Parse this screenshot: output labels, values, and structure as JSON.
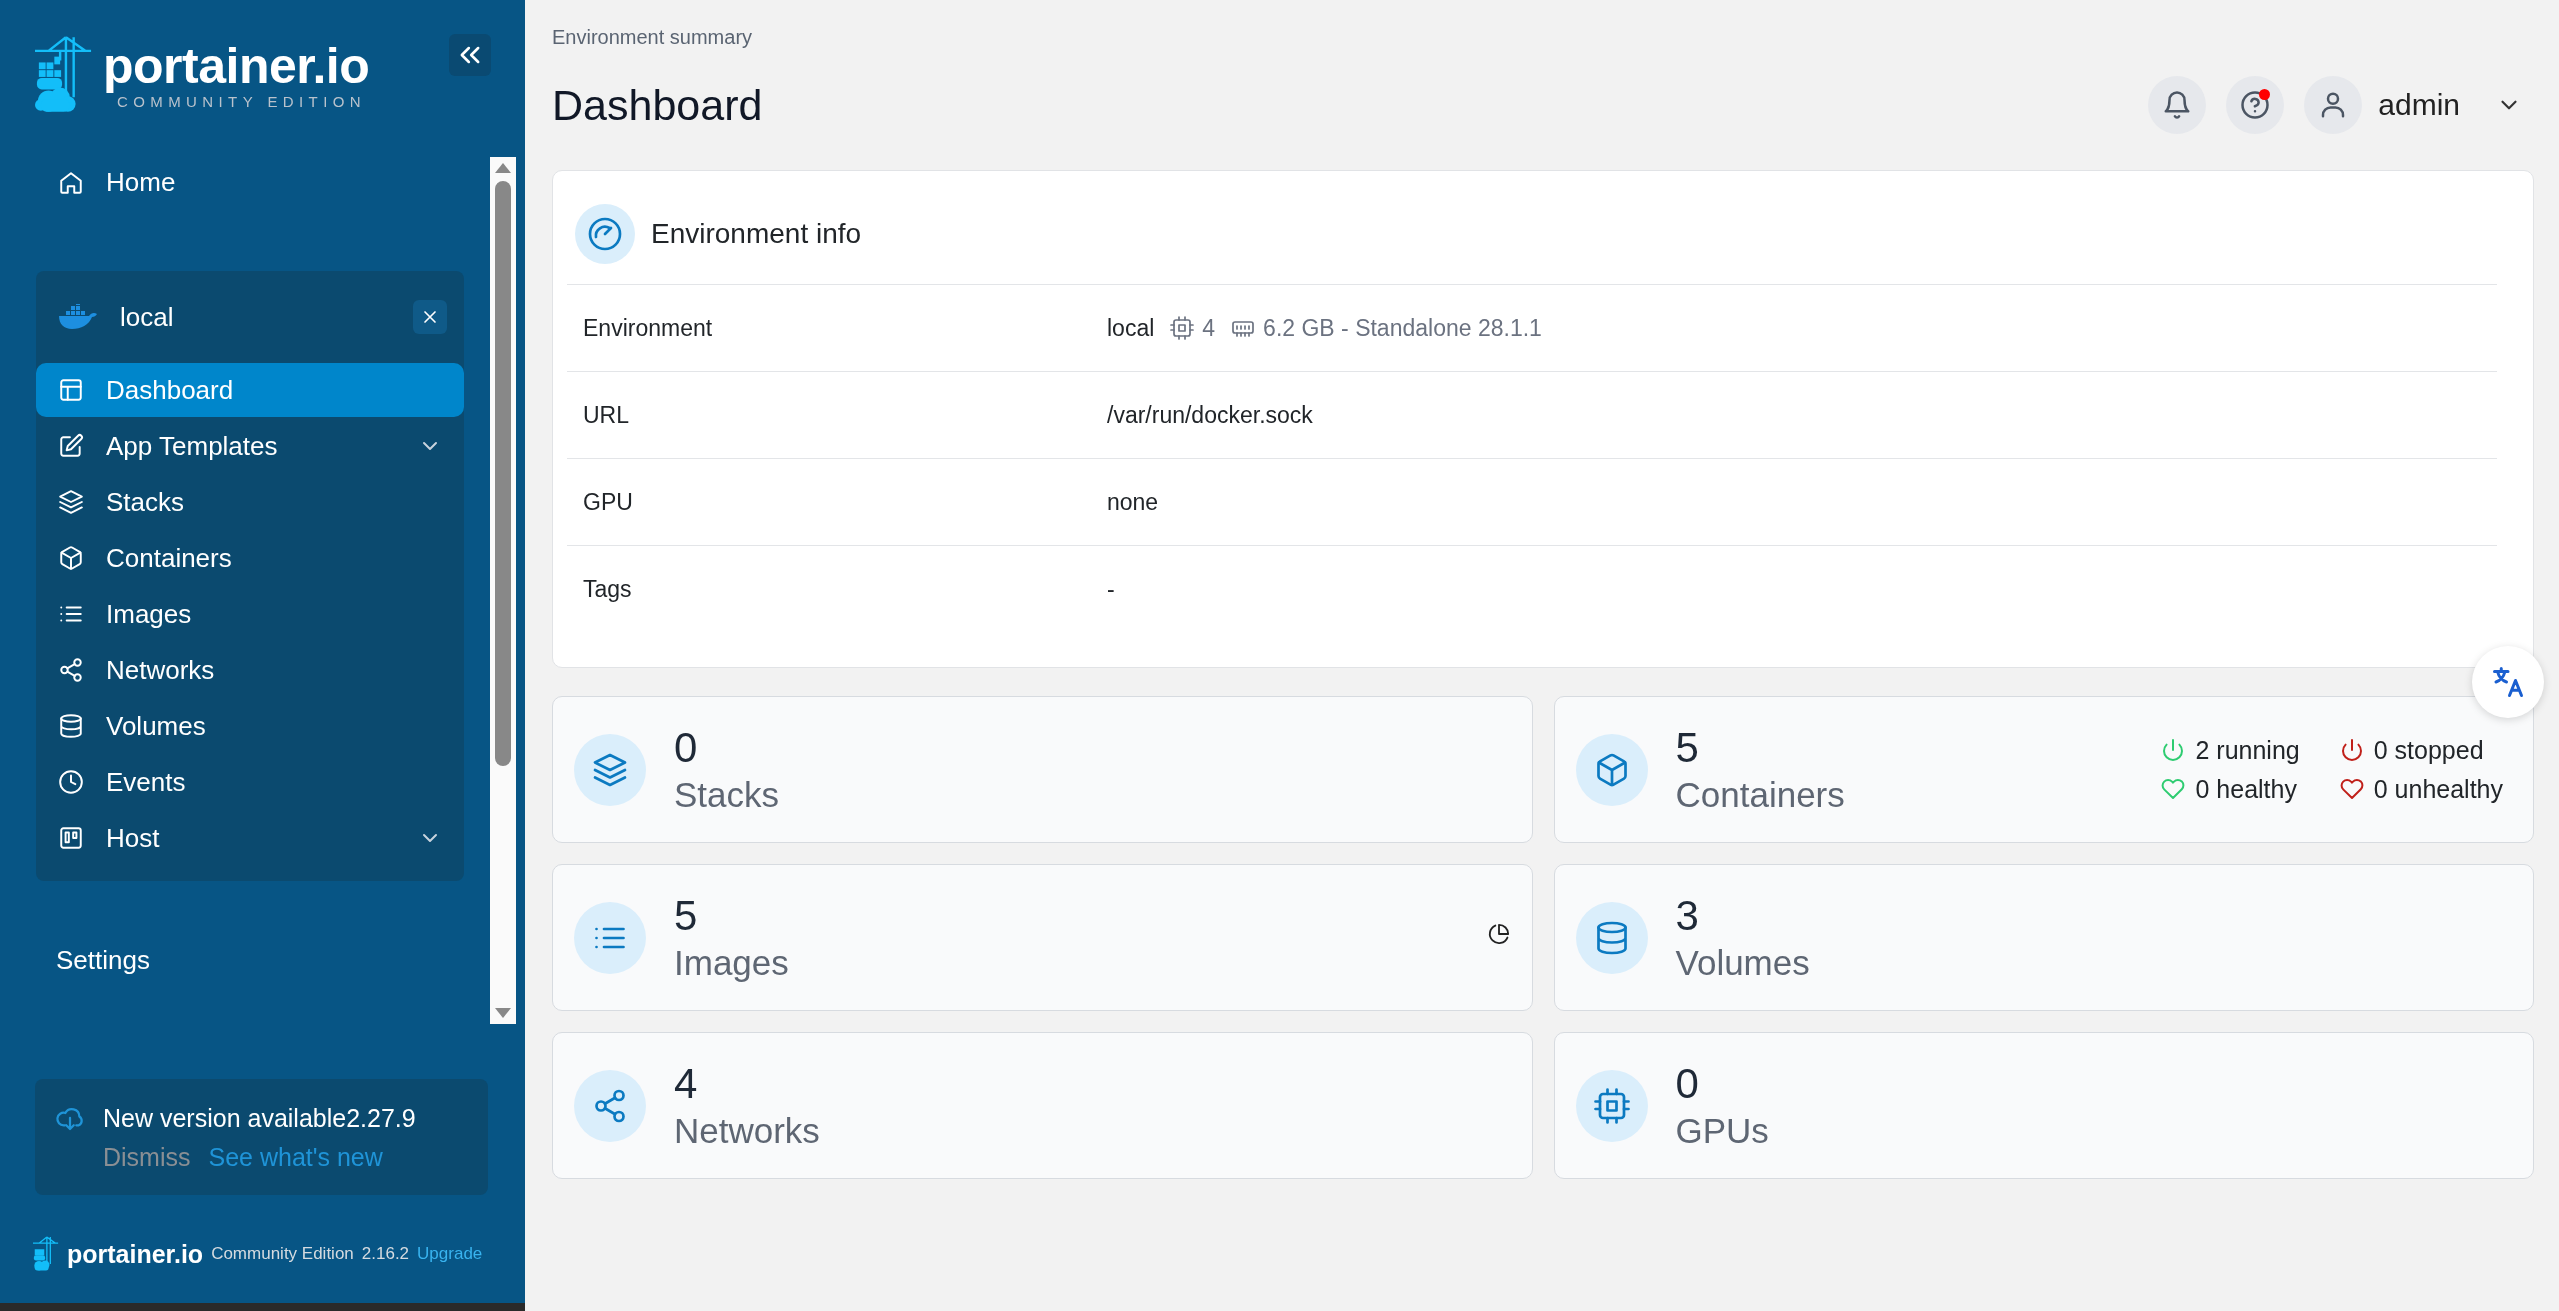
{
  "sidebar": {
    "logo": {
      "name": "portainer.io",
      "edition": "COMMUNITY EDITION"
    },
    "home": {
      "label": "Home",
      "kind": "home",
      "selected": false
    },
    "environment": {
      "name": "local",
      "items": [
        {
          "label": "Dashboard",
          "kind": "dashboard",
          "selected": true,
          "expandable": false
        },
        {
          "label": "App Templates",
          "kind": "edit",
          "selected": false,
          "expandable": true
        },
        {
          "label": "Stacks",
          "kind": "layers",
          "selected": false,
          "expandable": false
        },
        {
          "label": "Containers",
          "kind": "box",
          "selected": false,
          "expandable": false
        },
        {
          "label": "Images",
          "kind": "list",
          "selected": false,
          "expandable": false
        },
        {
          "label": "Networks",
          "kind": "share",
          "selected": false,
          "expandable": false
        },
        {
          "label": "Volumes",
          "kind": "database",
          "selected": false,
          "expandable": false
        },
        {
          "label": "Events",
          "kind": "clock",
          "selected": false,
          "expandable": false
        },
        {
          "label": "Host",
          "kind": "host",
          "selected": false,
          "expandable": true
        }
      ]
    },
    "settings": {
      "label": "Settings",
      "selected": false
    },
    "update": {
      "title": "New version available2.27.9",
      "dismiss": "Dismiss",
      "link": "See what's new"
    },
    "footer": {
      "brand": "portainer.io",
      "edition": "Community Edition",
      "version": "2.16.2",
      "upgrade": "Upgrade"
    }
  },
  "header": {
    "breadcrumb": "Environment summary",
    "title": "Dashboard",
    "help_notification": true,
    "user": "admin"
  },
  "environment_info": {
    "title": "Environment info",
    "rows": [
      {
        "kind": "environment",
        "label": "Environment",
        "value": "local",
        "cpu": "4",
        "memory": "6.2 GB - Standalone 28.1.1"
      },
      {
        "kind": "text",
        "label": "URL",
        "value": "/var/run/docker.sock"
      },
      {
        "kind": "text",
        "label": "GPU",
        "value": "none"
      },
      {
        "kind": "text",
        "label": "Tags",
        "value": "-"
      }
    ]
  },
  "stats": [
    {
      "kind": "layers",
      "count": "0",
      "label": "Stacks"
    },
    {
      "kind": "box",
      "count": "5",
      "label": "Containers",
      "statuses": [
        {
          "kind": "power",
          "color": "#2ecc71",
          "text": "2 running"
        },
        {
          "kind": "power",
          "color": "#c0201a",
          "text": "0 stopped"
        },
        {
          "kind": "heart",
          "color": "#2ecc71",
          "text": "0 healthy"
        },
        {
          "kind": "heart",
          "color": "#c0201a",
          "text": "0 unhealthy"
        }
      ]
    },
    {
      "kind": "list",
      "count": "5",
      "label": "Images",
      "usage_icon": true
    },
    {
      "kind": "database",
      "count": "3",
      "label": "Volumes"
    },
    {
      "kind": "share",
      "count": "4",
      "label": "Networks"
    },
    {
      "kind": "cpu",
      "count": "0",
      "label": "GPUs"
    }
  ]
}
